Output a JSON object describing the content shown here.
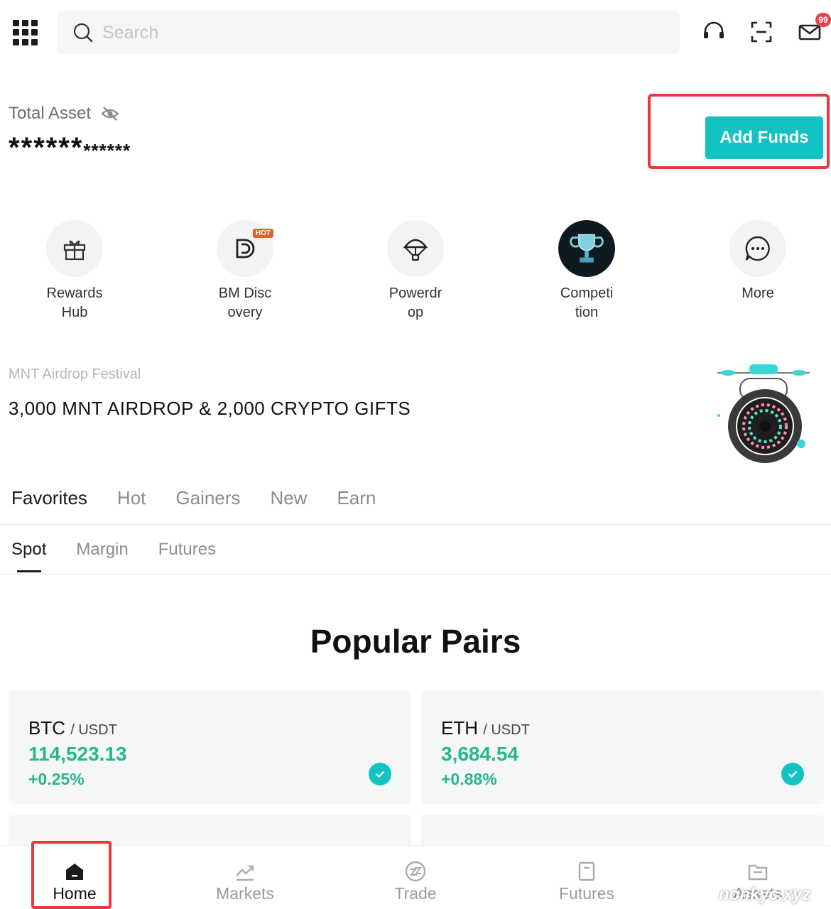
{
  "header": {
    "search_placeholder": "Search",
    "mail_badge": "99"
  },
  "asset": {
    "label": "Total Asset",
    "value_main": "******",
    "value_small": "******",
    "add_funds": "Add Funds"
  },
  "quick_items": [
    {
      "label_line1": "Rewards",
      "label_line2": "Hub",
      "icon": "gift-icon"
    },
    {
      "label_line1": "BM Disc",
      "label_line2": "overy",
      "icon": "discovery-icon",
      "badge": "HOT"
    },
    {
      "label_line1": "Powerdr",
      "label_line2": "op",
      "icon": "parachute-icon"
    },
    {
      "label_line1": "Competi",
      "label_line2": "tion",
      "icon": "trophy-icon"
    },
    {
      "label_line1": "More",
      "label_line2": "",
      "icon": "more-icon"
    }
  ],
  "banner": {
    "subtitle": "MNT Airdrop Festival",
    "title": "3,000 MNT AIRDROP & 2,000 CRYPTO GIFTS"
  },
  "tabs": [
    "Favorites",
    "Hot",
    "Gainers",
    "New",
    "Earn"
  ],
  "subtabs": [
    "Spot",
    "Margin",
    "Futures"
  ],
  "popular_title": "Popular Pairs",
  "pairs": [
    {
      "base": "BTC",
      "quote": "/ USDT",
      "price": "114,523.13",
      "change": "+0.25%"
    },
    {
      "base": "ETH",
      "quote": "/ USDT",
      "price": "3,684.54",
      "change": "+0.88%"
    }
  ],
  "bottom_nav": [
    "Home",
    "Markets",
    "Trade",
    "Futures",
    "Assets"
  ],
  "watermark": "nonkyc.xyz",
  "colors": {
    "accent": "#13c2c2",
    "positive": "#25b98a",
    "highlight_frame": "#e8383d"
  }
}
